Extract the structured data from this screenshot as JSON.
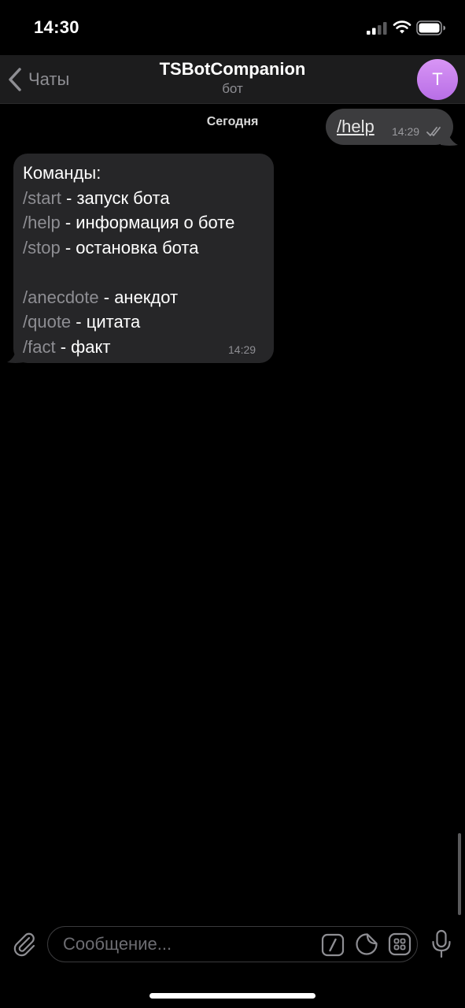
{
  "status_bar": {
    "time": "14:30"
  },
  "nav": {
    "back_label": "Чаты",
    "title": "TSBotCompanion",
    "subtitle": "бот",
    "avatar_letter": "T"
  },
  "chat": {
    "date_label": "Сегодня",
    "outgoing": {
      "text": "/help",
      "time": "14:29"
    },
    "incoming": {
      "heading": "Команды:",
      "lines": [
        {
          "command": "/start",
          "description": " - запуск бота"
        },
        {
          "command": "/help",
          "description": " - информация о боте"
        },
        {
          "command": "/stop",
          "description": " - остановка бота"
        },
        {
          "command": "/anecdote",
          "description": " - анекдот"
        },
        {
          "command": "/quote",
          "description": " - цитата"
        },
        {
          "command": "/fact",
          "description": " - факт"
        }
      ],
      "time": "14:29"
    }
  },
  "input": {
    "placeholder": "Сообщение..."
  },
  "icons": {
    "back": "chevron-left-icon",
    "attach": "paperclip-icon",
    "commands": "slash-command-icon",
    "sticker": "sticker-icon",
    "attach_menu": "grid-icon",
    "voice": "microphone-icon"
  },
  "colors": {
    "background": "#000000",
    "bubble_out": "#3c3c3e",
    "bubble_in": "#262628",
    "avatar_gradient_top": "#d895f5",
    "avatar_gradient_bottom": "#b86ee6",
    "secondary_text": "#8e8e93"
  }
}
